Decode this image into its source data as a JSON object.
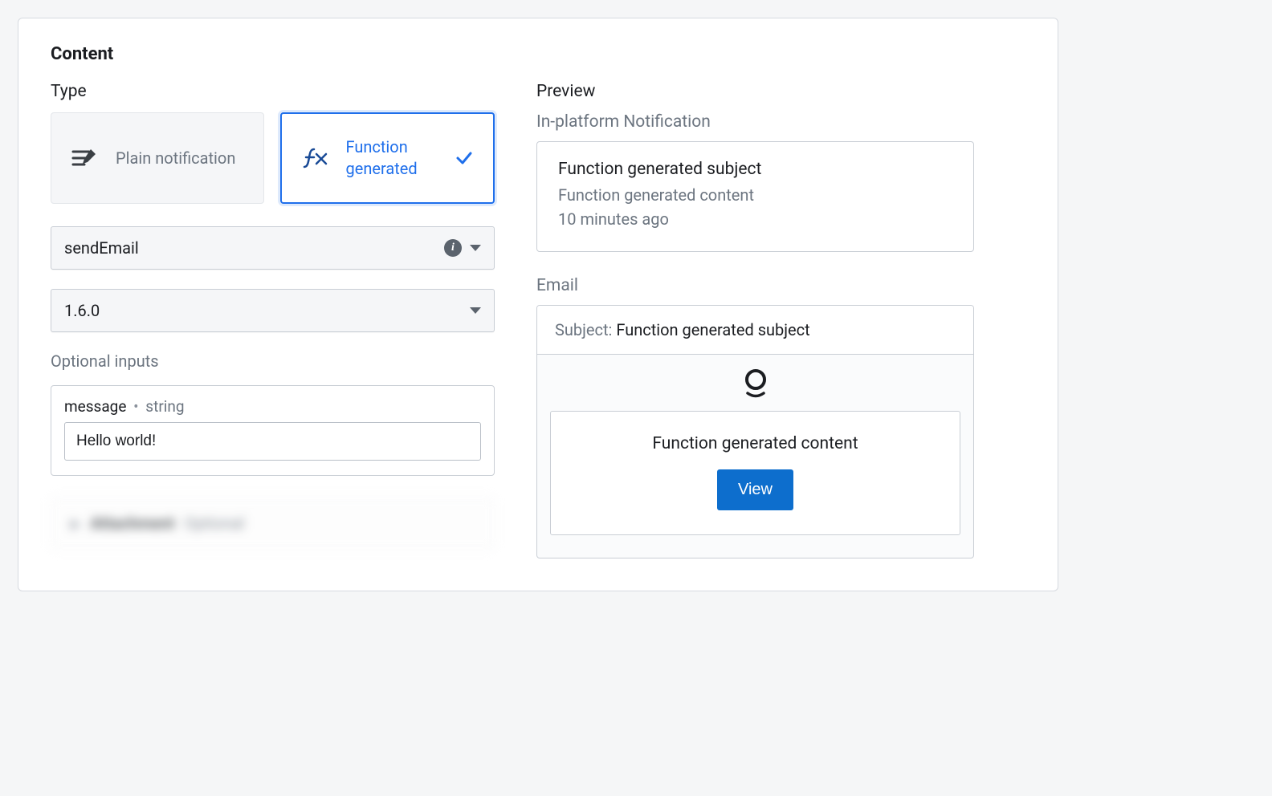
{
  "section_title": "Content",
  "left": {
    "type_label": "Type",
    "options": {
      "plain": {
        "label": "Plain notification"
      },
      "function": {
        "label": "Function generated"
      }
    },
    "function_select": {
      "value": "sendEmail"
    },
    "version_select": {
      "value": "1.6.0"
    },
    "optional_inputs_label": "Optional inputs",
    "message_input": {
      "name": "message",
      "type": "string",
      "value": "Hello world!"
    },
    "blurred": {
      "label": "Attachment",
      "hint": "Optional"
    }
  },
  "right": {
    "preview_label": "Preview",
    "inplatform_label": "In-platform Notification",
    "notification": {
      "subject": "Function generated subject",
      "content": "Function generated content",
      "time": "10 minutes ago"
    },
    "email_label": "Email",
    "email": {
      "subject_label": "Subject:",
      "subject": "Function generated subject",
      "content": "Function generated content",
      "view_label": "View"
    }
  }
}
